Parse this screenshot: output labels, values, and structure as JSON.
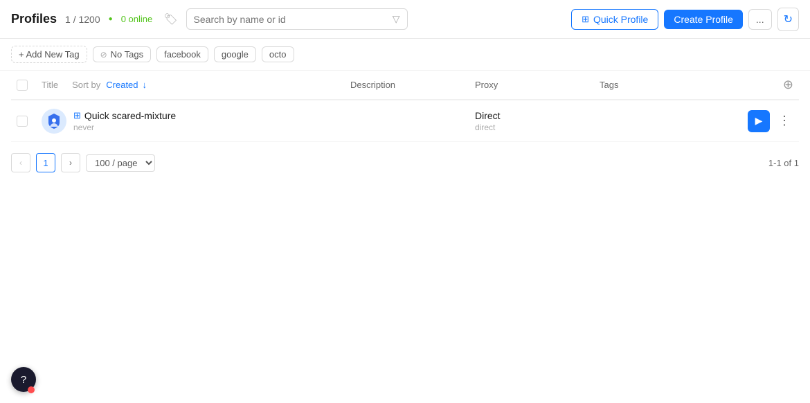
{
  "header": {
    "title": "Profiles",
    "count": "1 / 1200",
    "online_count": "0 online",
    "search_placeholder": "Search by name or id",
    "quick_profile_label": "Quick Profile",
    "create_profile_label": "Create Profile",
    "more_label": "...",
    "refresh_icon": "↻"
  },
  "tags_bar": {
    "add_tag_label": "+ Add New Tag",
    "tags": [
      {
        "id": "no-tags",
        "label": "No Tags",
        "has_eye": true
      },
      {
        "id": "facebook",
        "label": "facebook"
      },
      {
        "id": "google",
        "label": "google"
      },
      {
        "id": "octo",
        "label": "octo"
      }
    ]
  },
  "table": {
    "columns": {
      "title": "Title",
      "sort_by": "Sort by",
      "sort_field": "Created",
      "description": "Description",
      "proxy": "Proxy",
      "tags": "Tags"
    },
    "rows": [
      {
        "id": "row-1",
        "name": "Quick scared-mixture",
        "subtitle": "never",
        "description": "",
        "proxy_type": "Direct",
        "proxy_sub": "direct",
        "tags": ""
      }
    ]
  },
  "pagination": {
    "prev_icon": "‹",
    "next_icon": "›",
    "current_page": "1",
    "page_size": "100 / page",
    "total": "1-1 of 1"
  },
  "help": {
    "icon": "?"
  },
  "colors": {
    "accent": "#1677ff",
    "online": "#52c41a"
  }
}
